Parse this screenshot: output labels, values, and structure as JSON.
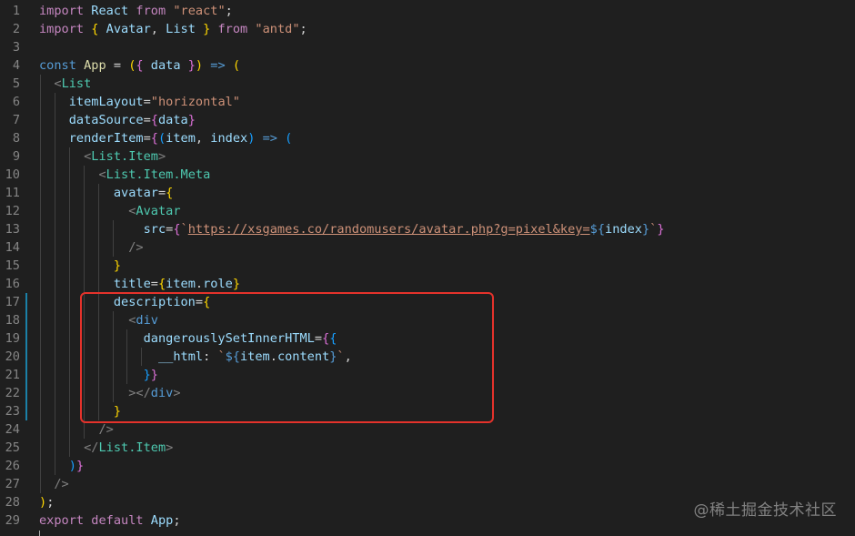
{
  "editor": {
    "lines": [
      {
        "n": "1",
        "tokens": [
          [
            "kw",
            "import"
          ],
          [
            "tx",
            " "
          ],
          [
            "var",
            "React"
          ],
          [
            "tx",
            " "
          ],
          [
            "kw",
            "from"
          ],
          [
            "tx",
            " "
          ],
          [
            "str",
            "\"react\""
          ],
          [
            "tx",
            ";"
          ]
        ]
      },
      {
        "n": "2",
        "tokens": [
          [
            "kw",
            "import"
          ],
          [
            "tx",
            " "
          ],
          [
            "b1",
            "{"
          ],
          [
            "tx",
            " "
          ],
          [
            "var",
            "Avatar"
          ],
          [
            "tx",
            ", "
          ],
          [
            "var",
            "List"
          ],
          [
            "tx",
            " "
          ],
          [
            "b1",
            "}"
          ],
          [
            "tx",
            " "
          ],
          [
            "kw",
            "from"
          ],
          [
            "tx",
            " "
          ],
          [
            "str",
            "\"antd\""
          ],
          [
            "tx",
            ";"
          ]
        ]
      },
      {
        "n": "3",
        "tokens": []
      },
      {
        "n": "4",
        "tokens": [
          [
            "sto",
            "const"
          ],
          [
            "tx",
            " "
          ],
          [
            "fn",
            "App"
          ],
          [
            "tx",
            " "
          ],
          [
            "op",
            "="
          ],
          [
            "tx",
            " "
          ],
          [
            "b1",
            "("
          ],
          [
            "b2",
            "{"
          ],
          [
            "tx",
            " "
          ],
          [
            "var",
            "data"
          ],
          [
            "tx",
            " "
          ],
          [
            "b2",
            "}"
          ],
          [
            "b1",
            ")"
          ],
          [
            "tx",
            " "
          ],
          [
            "sto",
            "=>"
          ],
          [
            "tx",
            " "
          ],
          [
            "b1",
            "("
          ]
        ]
      },
      {
        "n": "5",
        "tokens": [
          [
            "tx",
            "  "
          ],
          [
            "tag",
            "<"
          ],
          [
            "comp",
            "List"
          ]
        ]
      },
      {
        "n": "6",
        "tokens": [
          [
            "tx",
            "    "
          ],
          [
            "var",
            "itemLayout"
          ],
          [
            "op",
            "="
          ],
          [
            "str",
            "\"horizontal\""
          ]
        ]
      },
      {
        "n": "7",
        "tokens": [
          [
            "tx",
            "    "
          ],
          [
            "var",
            "dataSource"
          ],
          [
            "op",
            "="
          ],
          [
            "b2",
            "{"
          ],
          [
            "var",
            "data"
          ],
          [
            "b2",
            "}"
          ]
        ]
      },
      {
        "n": "8",
        "tokens": [
          [
            "tx",
            "    "
          ],
          [
            "var",
            "renderItem"
          ],
          [
            "op",
            "="
          ],
          [
            "b2",
            "{"
          ],
          [
            "b3",
            "("
          ],
          [
            "var",
            "item"
          ],
          [
            "tx",
            ", "
          ],
          [
            "var",
            "index"
          ],
          [
            "b3",
            ")"
          ],
          [
            "tx",
            " "
          ],
          [
            "sto",
            "=>"
          ],
          [
            "tx",
            " "
          ],
          [
            "b3",
            "("
          ]
        ]
      },
      {
        "n": "9",
        "tokens": [
          [
            "tx",
            "      "
          ],
          [
            "tag",
            "<"
          ],
          [
            "comp",
            "List.Item"
          ],
          [
            "tag",
            ">"
          ]
        ]
      },
      {
        "n": "10",
        "tokens": [
          [
            "tx",
            "        "
          ],
          [
            "tag",
            "<"
          ],
          [
            "comp",
            "List.Item.Meta"
          ]
        ]
      },
      {
        "n": "11",
        "tokens": [
          [
            "tx",
            "          "
          ],
          [
            "var",
            "avatar"
          ],
          [
            "op",
            "="
          ],
          [
            "b1",
            "{"
          ]
        ]
      },
      {
        "n": "12",
        "tokens": [
          [
            "tx",
            "            "
          ],
          [
            "tag",
            "<"
          ],
          [
            "comp",
            "Avatar"
          ]
        ]
      },
      {
        "n": "13",
        "tokens": [
          [
            "tx",
            "              "
          ],
          [
            "var",
            "src"
          ],
          [
            "op",
            "="
          ],
          [
            "b2",
            "{"
          ],
          [
            "str",
            "`"
          ],
          [
            "lnk",
            "https://xsgames.co/randomusers/avatar.php?g=pixel&key="
          ],
          [
            "tpl",
            "${"
          ],
          [
            "var",
            "index"
          ],
          [
            "tpl",
            "}"
          ],
          [
            "str",
            "`"
          ],
          [
            "b2",
            "}"
          ]
        ]
      },
      {
        "n": "14",
        "tokens": [
          [
            "tx",
            "            "
          ],
          [
            "tag",
            "/>"
          ]
        ]
      },
      {
        "n": "15",
        "tokens": [
          [
            "tx",
            "          "
          ],
          [
            "b1",
            "}"
          ]
        ]
      },
      {
        "n": "16",
        "tokens": [
          [
            "tx",
            "          "
          ],
          [
            "var",
            "title"
          ],
          [
            "op",
            "="
          ],
          [
            "b1",
            "{"
          ],
          [
            "var",
            "item"
          ],
          [
            "tx",
            "."
          ],
          [
            "var",
            "role"
          ],
          [
            "b1",
            "}"
          ]
        ]
      },
      {
        "n": "17",
        "tokens": [
          [
            "tx",
            "          "
          ],
          [
            "var",
            "description"
          ],
          [
            "op",
            "="
          ],
          [
            "b1",
            "{"
          ]
        ]
      },
      {
        "n": "18",
        "tokens": [
          [
            "tx",
            "            "
          ],
          [
            "tag",
            "<"
          ],
          [
            "sto",
            "div"
          ]
        ]
      },
      {
        "n": "19",
        "tokens": [
          [
            "tx",
            "              "
          ],
          [
            "var",
            "dangerouslySetInnerHTML"
          ],
          [
            "op",
            "="
          ],
          [
            "b2",
            "{"
          ],
          [
            "b3",
            "{"
          ]
        ]
      },
      {
        "n": "20",
        "tokens": [
          [
            "tx",
            "                "
          ],
          [
            "var",
            "__html"
          ],
          [
            "tx",
            ": "
          ],
          [
            "str",
            "`"
          ],
          [
            "tpl",
            "${"
          ],
          [
            "var",
            "item"
          ],
          [
            "tx",
            "."
          ],
          [
            "var",
            "content"
          ],
          [
            "tpl",
            "}"
          ],
          [
            "str",
            "`"
          ],
          [
            "tx",
            ","
          ]
        ]
      },
      {
        "n": "21",
        "tokens": [
          [
            "tx",
            "              "
          ],
          [
            "b3",
            "}"
          ],
          [
            "b2",
            "}"
          ]
        ]
      },
      {
        "n": "22",
        "tokens": [
          [
            "tx",
            "            "
          ],
          [
            "tag",
            "></"
          ],
          [
            "sto",
            "div"
          ],
          [
            "tag",
            ">"
          ]
        ]
      },
      {
        "n": "23",
        "tokens": [
          [
            "tx",
            "          "
          ],
          [
            "b1",
            "}"
          ]
        ]
      },
      {
        "n": "24",
        "tokens": [
          [
            "tx",
            "        "
          ],
          [
            "tag",
            "/>"
          ]
        ]
      },
      {
        "n": "25",
        "tokens": [
          [
            "tx",
            "      "
          ],
          [
            "tag",
            "</"
          ],
          [
            "comp",
            "List.Item"
          ],
          [
            "tag",
            ">"
          ]
        ]
      },
      {
        "n": "26",
        "tokens": [
          [
            "tx",
            "    "
          ],
          [
            "b3",
            ")"
          ],
          [
            "b2",
            "}"
          ]
        ]
      },
      {
        "n": "27",
        "tokens": [
          [
            "tx",
            "  "
          ],
          [
            "tag",
            "/>"
          ]
        ]
      },
      {
        "n": "28",
        "tokens": [
          [
            "b1",
            ")"
          ],
          [
            "tx",
            ";"
          ]
        ]
      },
      {
        "n": "29",
        "tokens": [
          [
            "kw",
            "export"
          ],
          [
            "tx",
            " "
          ],
          [
            "kw",
            "default"
          ],
          [
            "tx",
            " "
          ],
          [
            "var",
            "App"
          ],
          [
            "tx",
            ";"
          ]
        ]
      }
    ]
  },
  "watermark": "@稀土掘金技术社区",
  "colors": {
    "background": "#1f1f1f",
    "highlight_border": "#e4322b",
    "line_number": "#858585"
  }
}
